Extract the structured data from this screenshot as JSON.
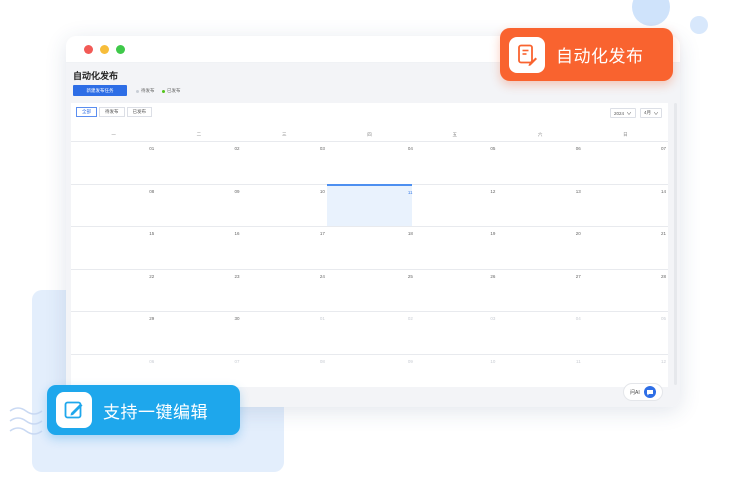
{
  "app": {
    "page_title": "自动化发布",
    "new_task_button": "新建发布任务",
    "legend": {
      "pending": "待发布",
      "published": "已发布",
      "pending_color": "#c9ced6",
      "published_color": "#52c41a"
    }
  },
  "filters": {
    "tabs": [
      {
        "label": "全部",
        "active": true
      },
      {
        "label": "待发布",
        "active": false
      },
      {
        "label": "已发布",
        "active": false
      }
    ],
    "year": "2024",
    "month": "4月"
  },
  "calendar": {
    "weekdays": [
      "一",
      "二",
      "三",
      "四",
      "五",
      "六",
      "日"
    ],
    "today": "11",
    "days": [
      {
        "d": "01",
        "muted": false
      },
      {
        "d": "02",
        "muted": false
      },
      {
        "d": "03",
        "muted": false
      },
      {
        "d": "04",
        "muted": false
      },
      {
        "d": "05",
        "muted": false
      },
      {
        "d": "06",
        "muted": false
      },
      {
        "d": "07",
        "muted": false
      },
      {
        "d": "08",
        "muted": false
      },
      {
        "d": "09",
        "muted": false
      },
      {
        "d": "10",
        "muted": false
      },
      {
        "d": "11",
        "muted": false
      },
      {
        "d": "12",
        "muted": false
      },
      {
        "d": "13",
        "muted": false
      },
      {
        "d": "14",
        "muted": false
      },
      {
        "d": "15",
        "muted": false
      },
      {
        "d": "16",
        "muted": false
      },
      {
        "d": "17",
        "muted": false
      },
      {
        "d": "18",
        "muted": false
      },
      {
        "d": "19",
        "muted": false
      },
      {
        "d": "20",
        "muted": false
      },
      {
        "d": "21",
        "muted": false
      },
      {
        "d": "22",
        "muted": false
      },
      {
        "d": "23",
        "muted": false
      },
      {
        "d": "24",
        "muted": false
      },
      {
        "d": "25",
        "muted": false
      },
      {
        "d": "26",
        "muted": false
      },
      {
        "d": "27",
        "muted": false
      },
      {
        "d": "28",
        "muted": false
      },
      {
        "d": "29",
        "muted": false
      },
      {
        "d": "30",
        "muted": false
      },
      {
        "d": "01",
        "muted": true
      },
      {
        "d": "02",
        "muted": true
      },
      {
        "d": "03",
        "muted": true
      },
      {
        "d": "04",
        "muted": true
      },
      {
        "d": "05",
        "muted": true
      },
      {
        "d": "06",
        "muted": true
      },
      {
        "d": "07",
        "muted": true
      },
      {
        "d": "08",
        "muted": true
      },
      {
        "d": "09",
        "muted": true
      },
      {
        "d": "10",
        "muted": true
      },
      {
        "d": "11",
        "muted": true
      },
      {
        "d": "12",
        "muted": true
      }
    ]
  },
  "ask_ai": {
    "label": "问AI"
  },
  "badges": {
    "auto_publish": "自动化发布",
    "one_click_edit": "支持一键编辑"
  },
  "colors": {
    "primary": "#2e6ee6",
    "orange_badge": "#f9632f",
    "blue_badge": "#1ea7ec",
    "today_bg": "#e9f2fd"
  }
}
